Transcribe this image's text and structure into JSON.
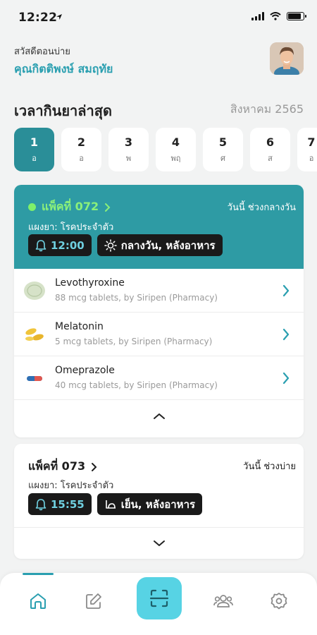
{
  "status_bar": {
    "time": "12:22"
  },
  "greeting": {
    "salutation": "สวัสดีตอนบ่าย",
    "user_name": "คุณกิตติพงษ์ สมฤทัย"
  },
  "section": {
    "title": "เวลากินยาล่าสุด",
    "month": "สิงหาคม 2565"
  },
  "days": [
    {
      "num": "1",
      "dow": "อ"
    },
    {
      "num": "2",
      "dow": "อ"
    },
    {
      "num": "3",
      "dow": "พ"
    },
    {
      "num": "4",
      "dow": "พฤ"
    },
    {
      "num": "5",
      "dow": "ศ"
    },
    {
      "num": "6",
      "dow": "ส"
    },
    {
      "num": "7",
      "dow": "อ"
    }
  ],
  "pack1": {
    "title": "แพ็คที่ 072",
    "when": "วันนี้ ช่วงกลางวัน",
    "regimen": "แผงยา: โรคประจำตัว",
    "time": "12:00",
    "period": "กลางวัน, หลังอาหาร",
    "meds": [
      {
        "name": "Levothyroxine",
        "desc": "88 mcg tablets, by Siripen (Pharmacy)"
      },
      {
        "name": "Melatonin",
        "desc": "5 mcg tablets, by Siripen (Pharmacy)"
      },
      {
        "name": "Omeprazole",
        "desc": "40 mcg tablets, by Siripen (Pharmacy)"
      }
    ]
  },
  "pack2": {
    "title": "แพ็คที่ 073",
    "when": "วันนี้ ช่วงบ่าย",
    "regimen": "แผงยา: โรคประจำตัว",
    "time": "15:55",
    "period": "เย็น, หลังอาหาร"
  },
  "colors": {
    "accent": "#2a9fb0",
    "teal_card": "#2e9ba4",
    "active_day": "#2a8e98",
    "scan_button": "#57d3e4"
  },
  "icons": {
    "nav": [
      "home-icon",
      "edit-icon",
      "scan-icon",
      "people-icon",
      "settings-icon"
    ]
  }
}
